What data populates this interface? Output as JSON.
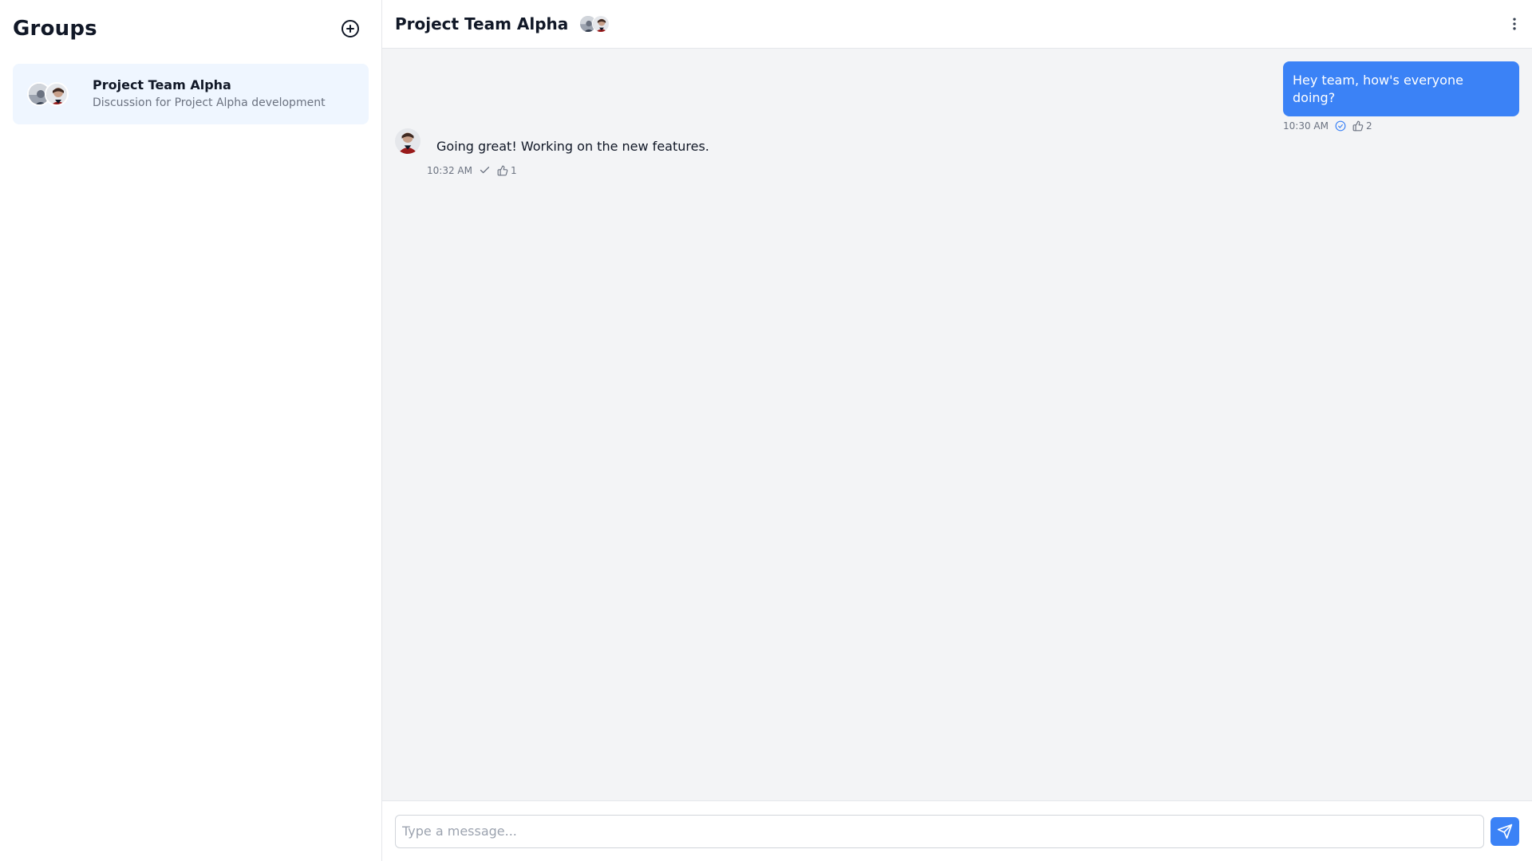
{
  "sidebar": {
    "title": "Groups",
    "add_icon": "plus-circle-icon",
    "groups": [
      {
        "name": "Project Team Alpha",
        "description": "Discussion for Project Alpha development",
        "selected": true
      }
    ]
  },
  "chat": {
    "title": "Project Team Alpha",
    "menu_icon": "more-vertical-icon",
    "messages": [
      {
        "direction": "outgoing",
        "text": "Hey team, how's everyone doing?",
        "time": "10:30 AM",
        "status_icon": "read-check-circle-icon",
        "likes": "2"
      },
      {
        "direction": "incoming",
        "text": "Going great! Working on the new features.",
        "time": "10:32 AM",
        "status_icon": "check-icon",
        "likes": "1"
      }
    ],
    "composer": {
      "placeholder": "Type a message...",
      "value": "",
      "send_icon": "send-icon"
    }
  },
  "colors": {
    "accent": "#3b82f6",
    "sidebar_selected_bg": "#eff6ff",
    "chat_bg": "#f3f4f6",
    "muted_text": "#6b7280"
  }
}
